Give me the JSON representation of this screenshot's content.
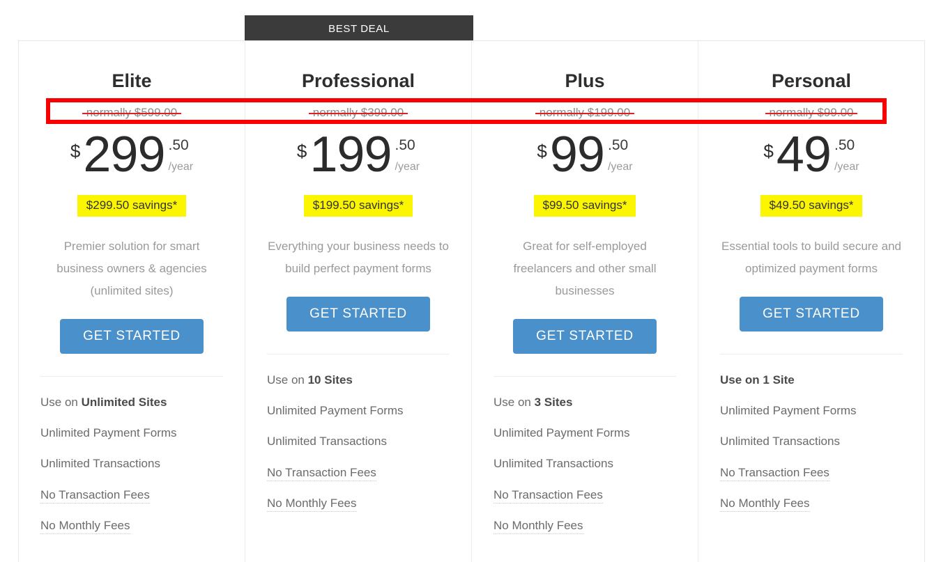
{
  "banner": {
    "label": "BEST DEAL",
    "highlight_plan": "Professional",
    "background_color": "#3b3b3b"
  },
  "colors": {
    "cta_blue": "#4a90cb",
    "savings_yellow": "#fbf500",
    "annotation_red": "#f90000",
    "strike_red": "#e02020",
    "heading_dark": "#2e2e2e",
    "muted_gray": "#9a9a9a"
  },
  "annotation": {
    "type": "rectangle-highlight",
    "target": "normally-price-row",
    "color": "#f90000",
    "stroke_width": 6
  },
  "cta_label": "GET STARTED",
  "plans": [
    {
      "name": "Elite",
      "normally": "normally $599.00",
      "currency": "$",
      "price_int": "299",
      "price_cents": ".50",
      "per": "/year",
      "savings": "$299.50 savings*",
      "description": "Premier solution for smart business owners & agencies (unlimited sites)",
      "features": [
        {
          "prefix": "Use on ",
          "bold": "Unlimited Sites",
          "suffix": "",
          "dotted": false,
          "all_bold": false
        },
        {
          "prefix": "Unlimited Payment Forms",
          "bold": "",
          "suffix": "",
          "dotted": false,
          "all_bold": false
        },
        {
          "prefix": "Unlimited Transactions",
          "bold": "",
          "suffix": "",
          "dotted": false,
          "all_bold": false
        },
        {
          "prefix": "No Transaction Fees",
          "bold": "",
          "suffix": "",
          "dotted": true,
          "all_bold": false
        },
        {
          "prefix": "No Monthly Fees",
          "bold": "",
          "suffix": "",
          "dotted": true,
          "all_bold": false
        }
      ]
    },
    {
      "name": "Professional",
      "normally": "normally $399.00",
      "currency": "$",
      "price_int": "199",
      "price_cents": ".50",
      "per": "/year",
      "savings": "$199.50 savings*",
      "description": "Everything your business needs to build perfect payment forms",
      "features": [
        {
          "prefix": "Use on ",
          "bold": "10 Sites",
          "suffix": "",
          "dotted": false,
          "all_bold": false
        },
        {
          "prefix": "Unlimited Payment Forms",
          "bold": "",
          "suffix": "",
          "dotted": false,
          "all_bold": false
        },
        {
          "prefix": "Unlimited Transactions",
          "bold": "",
          "suffix": "",
          "dotted": false,
          "all_bold": false
        },
        {
          "prefix": "No Transaction Fees",
          "bold": "",
          "suffix": "",
          "dotted": true,
          "all_bold": false
        },
        {
          "prefix": "No Monthly Fees",
          "bold": "",
          "suffix": "",
          "dotted": true,
          "all_bold": false
        }
      ]
    },
    {
      "name": "Plus",
      "normally": "normally $199.00",
      "currency": "$",
      "price_int": "99",
      "price_cents": ".50",
      "per": "/year",
      "savings": "$99.50 savings*",
      "description": "Great for self-employed freelancers and other small businesses",
      "features": [
        {
          "prefix": "Use on ",
          "bold": "3 Sites",
          "suffix": "",
          "dotted": false,
          "all_bold": false
        },
        {
          "prefix": "Unlimited Payment Forms",
          "bold": "",
          "suffix": "",
          "dotted": false,
          "all_bold": false
        },
        {
          "prefix": "Unlimited Transactions",
          "bold": "",
          "suffix": "",
          "dotted": false,
          "all_bold": false
        },
        {
          "prefix": "No Transaction Fees",
          "bold": "",
          "suffix": "",
          "dotted": true,
          "all_bold": false
        },
        {
          "prefix": "No Monthly Fees",
          "bold": "",
          "suffix": "",
          "dotted": true,
          "all_bold": false
        }
      ]
    },
    {
      "name": "Personal",
      "normally": "normally $99.00",
      "currency": "$",
      "price_int": "49",
      "price_cents": ".50",
      "per": "/year",
      "savings": "$49.50 savings*",
      "description": "Essential tools to build secure and optimized payment forms",
      "features": [
        {
          "prefix": "Use on 1 Site",
          "bold": "",
          "suffix": "",
          "dotted": false,
          "all_bold": true
        },
        {
          "prefix": "Unlimited Payment Forms",
          "bold": "",
          "suffix": "",
          "dotted": false,
          "all_bold": false
        },
        {
          "prefix": "Unlimited Transactions",
          "bold": "",
          "suffix": "",
          "dotted": false,
          "all_bold": false
        },
        {
          "prefix": "No Transaction Fees",
          "bold": "",
          "suffix": "",
          "dotted": true,
          "all_bold": false
        },
        {
          "prefix": "No Monthly Fees",
          "bold": "",
          "suffix": "",
          "dotted": true,
          "all_bold": false
        }
      ]
    }
  ]
}
